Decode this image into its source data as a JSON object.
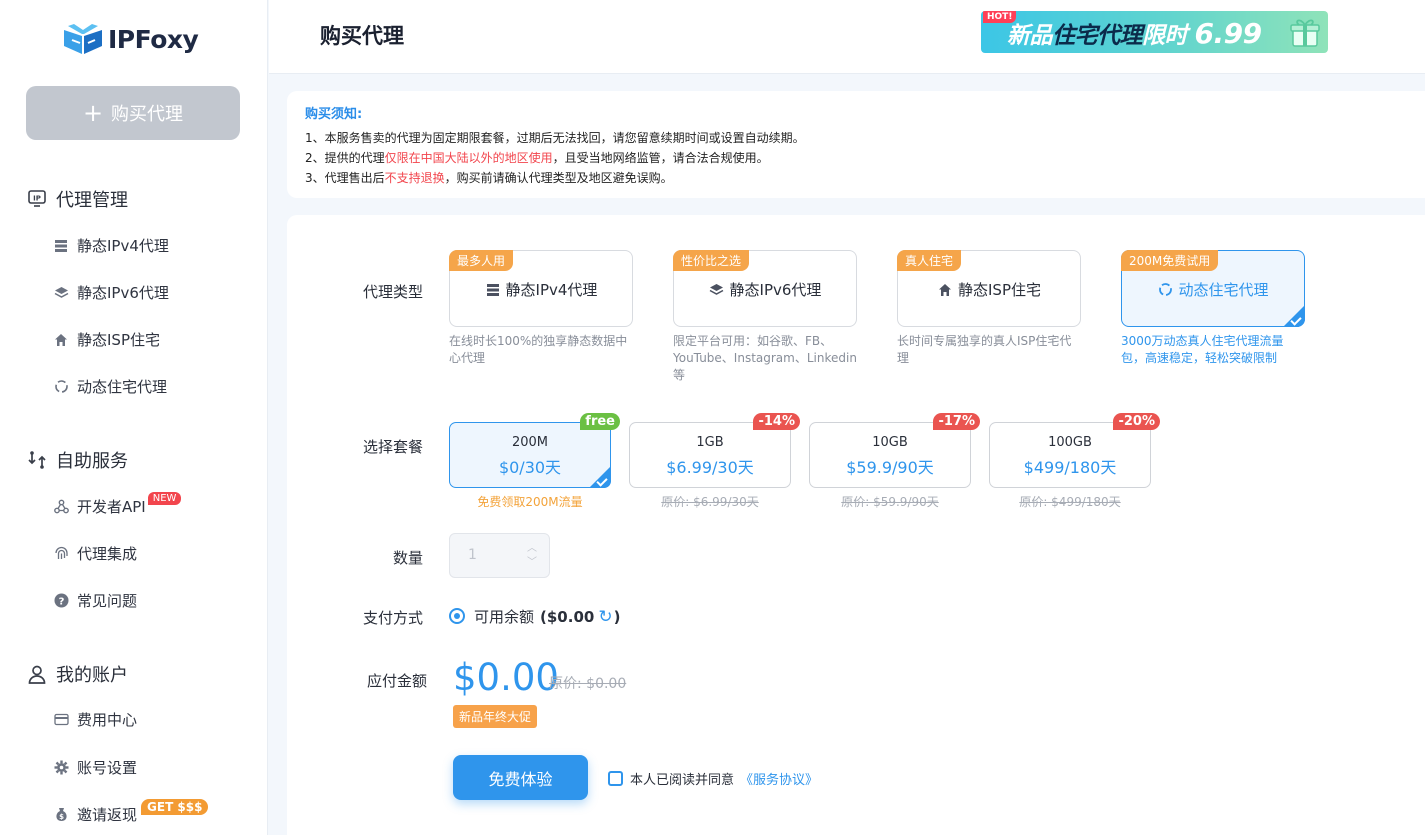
{
  "brand": {
    "name": "IPFoxy"
  },
  "sidebar": {
    "buy_button": "购买代理",
    "groups": [
      {
        "title": "代理管理",
        "items": [
          "静态IPv4代理",
          "静态IPv6代理",
          "静态ISP住宅",
          "动态住宅代理"
        ]
      },
      {
        "title": "自助服务",
        "items": [
          "开发者API",
          "代理集成",
          "常见问题"
        ]
      },
      {
        "title": "我的账户",
        "items": [
          "费用中心",
          "账号设置",
          "邀请返现"
        ]
      }
    ],
    "badge_new": "NEW",
    "badge_get": "GET $$$"
  },
  "header": {
    "title": "购买代理",
    "promo_hot": "HOT!",
    "promo_text_a": "新品",
    "promo_text_b": "住宅代理",
    "promo_text_c": "限时",
    "promo_price": "6.99"
  },
  "notice": {
    "title": "购买须知:",
    "line1": "1、本服务售卖的代理为固定期限套餐，过期后无法找回，请您留意续期时间或设置自动续期。",
    "line2_a": "2、提供的代理",
    "line2_red": "仅限在中国大陆以外的地区使用",
    "line2_b": "，且受当地网络监管，请合法合规使用。",
    "line3_a": "3、代理售出后",
    "line3_red": "不支持退换",
    "line3_b": "，购买前请确认代理类型及地区避免误购。"
  },
  "form": {
    "type_label": "代理类型",
    "plan_label": "选择套餐",
    "qty_label": "数量",
    "pay_label": "支付方式",
    "amount_label": "应付金额",
    "types": [
      {
        "tag": "最多人用",
        "name": "静态IPv4代理",
        "desc": "在线时长100%的独享静态数据中心代理"
      },
      {
        "tag": "性价比之选",
        "name": "静态IPv6代理",
        "desc": "限定平台可用：如谷歌、FB、YouTube、Instagram、Linkedin等"
      },
      {
        "tag": "真人住宅",
        "name": "静态ISP住宅",
        "desc": "长时间专属独享的真人ISP住宅代理"
      },
      {
        "tag": "200M免费试用",
        "name": "动态住宅代理",
        "desc": "3000万动态真人住宅代理流量包，高速稳定，轻松突破限制"
      }
    ],
    "plans": [
      {
        "name": "200M",
        "price": "$0/30天",
        "badge": "free",
        "sub": "免费领取200M流量"
      },
      {
        "name": "1GB",
        "price": "$6.99/30天",
        "badge": "-14%",
        "sub": "原价: $6.99/30天"
      },
      {
        "name": "10GB",
        "price": "$59.9/90天",
        "badge": "-17%",
        "sub": "原价: $59.9/90天"
      },
      {
        "name": "100GB",
        "price": "$499/180天",
        "badge": "-20%",
        "sub": "原价: $499/180天"
      }
    ],
    "quantity": "1",
    "pay_option_a": "可用余额",
    "pay_option_b": "($0.00",
    "pay_option_c": ")",
    "total": "$0.00",
    "original": "原价: $0.00",
    "promo_tag": "新品年终大促",
    "submit": "免费体验",
    "agree_text": "本人已阅读并同意",
    "agree_link": "《服务协议》"
  },
  "colors": {
    "accent": "#2f95ec",
    "tag": "#f5a54a",
    "danger": "#ea5450",
    "free": "#6bc043"
  }
}
